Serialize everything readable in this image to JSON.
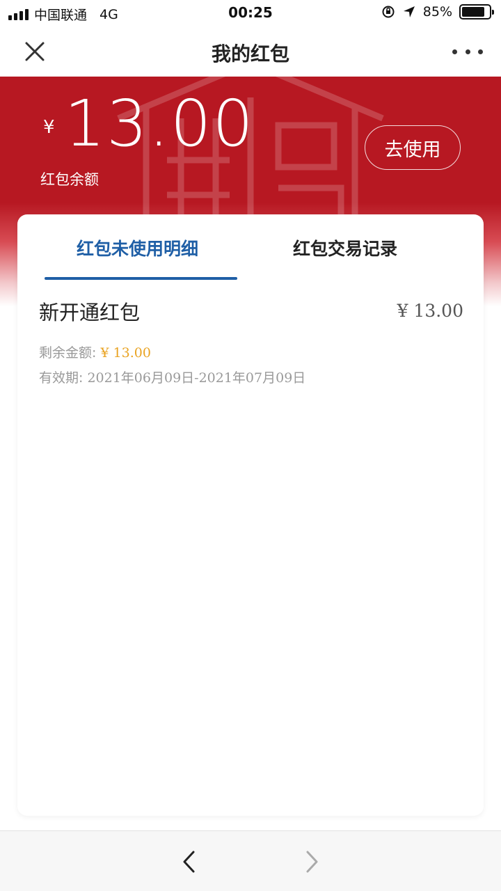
{
  "status_bar": {
    "carrier": "中国联通",
    "network": "4G",
    "time": "00:25",
    "battery": "85%",
    "battery_level": 0.85
  },
  "nav": {
    "title": "我的红包",
    "close_icon": "close-icon",
    "more_icon": "more-dots-icon"
  },
  "header": {
    "currency": "¥",
    "amount": "13.00",
    "balance_label": "红包余额",
    "use_button": "去使用",
    "color": "#b71822"
  },
  "tabs": [
    {
      "label": "红包未使用明细",
      "active": true
    },
    {
      "label": "红包交易记录",
      "active": false
    }
  ],
  "items": [
    {
      "title": "新开通红包",
      "amount": "¥ 13.00",
      "remain_label": "剩余金额:",
      "remain_value": "¥ 13.00",
      "validity_label": "有效期:",
      "validity_value": "2021年06月09日-2021年07月09日"
    }
  ],
  "bottom_bar": {
    "back_icon": "chevron-left-icon",
    "forward_icon": "chevron-right-icon"
  },
  "colors": {
    "accent_blue": "#1f5fa6",
    "remain_amount": "#e9a322"
  }
}
